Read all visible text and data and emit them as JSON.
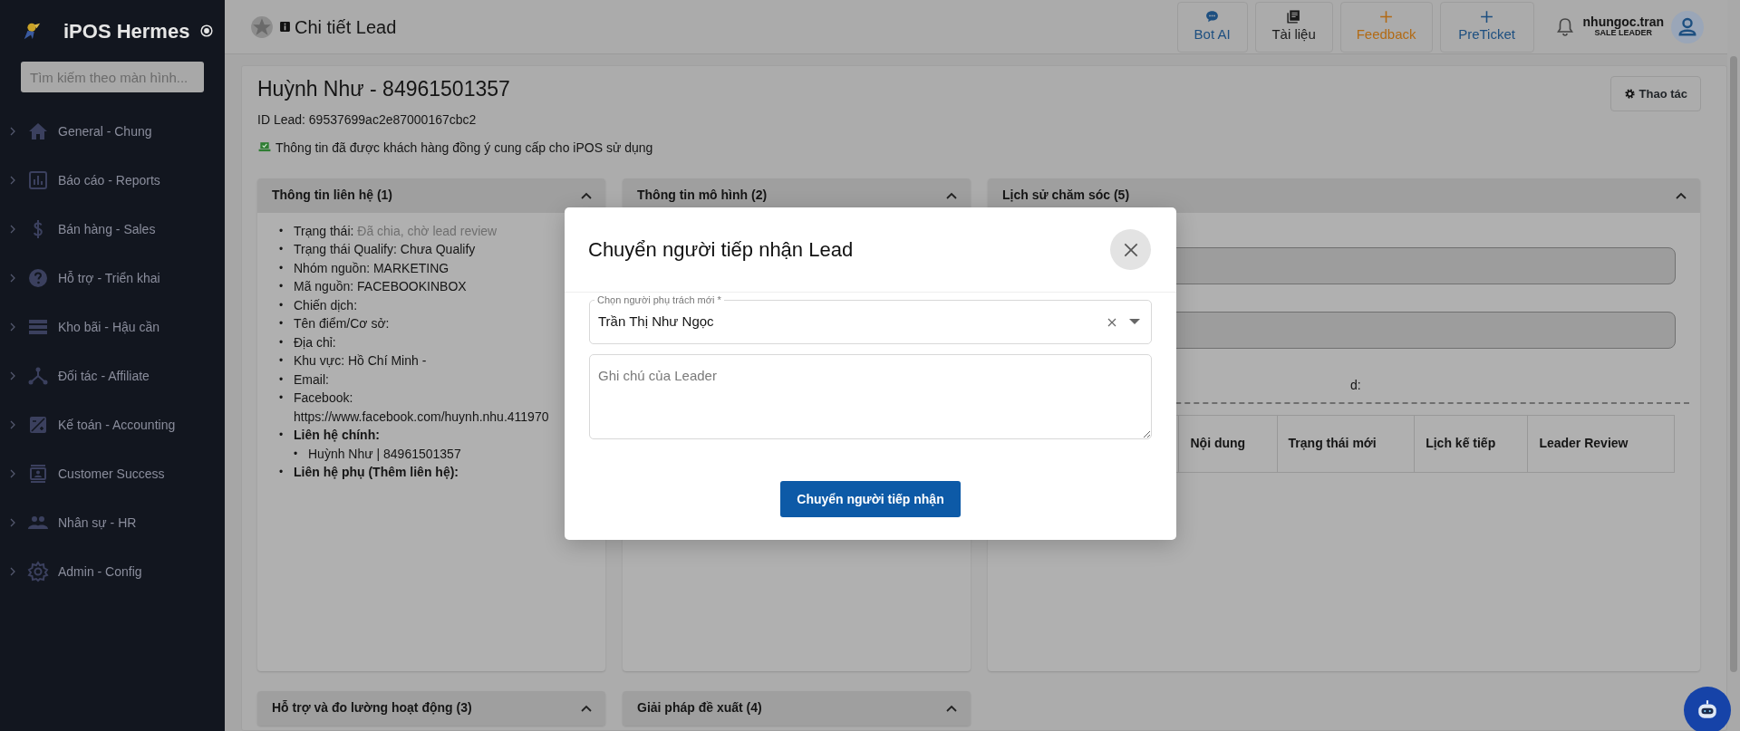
{
  "sidebar": {
    "brand": "iPOS Hermes",
    "search": {
      "placeholder": "Tìm kiếm theo màn hình..."
    },
    "items": [
      {
        "label": "General - Chung",
        "expanded": false
      },
      {
        "label": "Báo cáo - Reports",
        "expanded": false
      },
      {
        "label": "Bán hàng - Sales",
        "expanded": false
      },
      {
        "label": "Hỗ trợ - Triển khai",
        "expanded": false
      },
      {
        "label": "Kho bãi - Hậu cần",
        "expanded": false
      },
      {
        "label": "Đối tác - Affiliate",
        "expanded": false
      },
      {
        "label": "Kế toán - Accounting",
        "expanded": false
      },
      {
        "label": "Customer Success",
        "expanded": false
      },
      {
        "label": "Nhân sự - HR",
        "expanded": false
      },
      {
        "label": "Admin - Config",
        "expanded": false
      }
    ]
  },
  "topbar": {
    "title": "Chi tiết Lead",
    "buttons": [
      {
        "label": "Bot AI",
        "color": "#1d4f80"
      },
      {
        "label": "Tài liệu",
        "color": "#1a1a1a"
      },
      {
        "label": "Feedback",
        "color": "#b26a14"
      },
      {
        "label": "PreTicket",
        "color": "#1d4f80"
      }
    ],
    "user": {
      "name": "nhungoc.tran",
      "role": "SALE LEADER"
    }
  },
  "lead": {
    "title": "Huỳnh Như - 84961501357",
    "id_line": "ID Lead: 69537699ac2e87000167cbc2",
    "consent": "Thông tin đã được khách hàng đồng ý cung cấp cho iPOS sử dụng",
    "action_button": "Thao tác"
  },
  "panels": [
    {
      "title": "Thông tin liên hệ (1)",
      "expanded": true,
      "kind": "contact",
      "bullet": "•",
      "items": [
        {
          "label": "Trạng thái:",
          "value": "Đã chia, chờ lead review",
          "muted": true
        },
        {
          "label": "Trạng thái Qualify:",
          "value": "Chưa Qualify",
          "muted": false
        },
        {
          "label": "Nhóm nguồn:",
          "value": "MARKETING",
          "muted": false
        },
        {
          "label": "Mã nguồn:",
          "value": "FACEBOOKINBOX",
          "muted": false
        },
        {
          "label": "Chiến dịch:"
        },
        {
          "label": "Tên điểm/Cơ sở:"
        },
        {
          "label": "Địa chỉ:"
        },
        {
          "label": "Khu vực:",
          "value": "Hồ Chí Minh -",
          "muted": false
        },
        {
          "label": "Email:"
        },
        {
          "label": "Facebook:",
          "value": "https://www.facebook.com/huynh.nhu.411970",
          "muted": false
        },
        {
          "label": "Liên hệ chính:",
          "bold": true,
          "children": [
            {
              "label": "Huỳnh Như | 84961501357"
            }
          ]
        },
        {
          "label": "Liên hệ phụ (Thêm liên hệ):",
          "bold": true
        }
      ]
    },
    {
      "title": "Thông tin mô hình (2)",
      "expanded": true,
      "kind": "model"
    },
    {
      "title": "Lịch sử chăm sóc (5)",
      "expanded": true,
      "kind": "history",
      "inputs": [
        {
          "disabled": true
        },
        {
          "disabled": true
        }
      ],
      "note_label": "d:",
      "columns": [
        "Nội dung",
        "Trạng thái mới",
        "Lịch kế tiếp",
        "Leader Review"
      ]
    },
    {
      "title": "Hỗ trợ và đo lường hoạt động (3)",
      "expanded": true,
      "kind": "collapsed_row"
    },
    {
      "title": "Giải pháp đề xuất (4)",
      "expanded": true,
      "kind": "collapsed_row"
    }
  ],
  "modal": {
    "title": "Chuyển người tiếp nhận Lead",
    "assignee": {
      "label": "Chọn người phụ trách mới *",
      "value": "Trần Thị Như Ngọc"
    },
    "note": {
      "placeholder": "Ghi chú của Leader"
    },
    "submit": "Chuyển người tiếp nhận"
  }
}
